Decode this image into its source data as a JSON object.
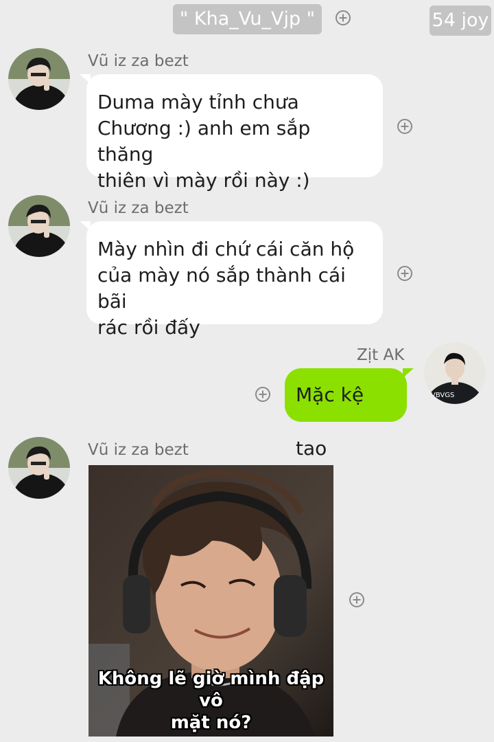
{
  "header": {
    "contact_name": "\" Kha_Vu_Vjp \"",
    "joy_count": "54 joy"
  },
  "messages": [
    {
      "sender": "Vũ iz za bezt",
      "text_lines": [
        "Duma mày tỉnh chưa",
        "Chương :) anh em sắp thăng",
        "thiên vì mày rồi này :)"
      ]
    },
    {
      "sender": "Vũ iz za bezt",
      "text_lines": [
        "Mày nhìn đi chứ cái căn hộ",
        "của mày nó sắp thành cái bãi",
        "rác rồi đấy"
      ]
    },
    {
      "sender": "Zịt AK",
      "text": "Mặc kệ tao"
    },
    {
      "sender": "Vũ iz za bezt",
      "image_caption_lines": [
        "Không lẽ giờ mình đập vô",
        "mặt nó?"
      ]
    }
  ],
  "icons": {
    "add": "plus-circle-icon",
    "avatar_in": "user-avatar",
    "avatar_out": "user-avatar"
  },
  "colors": {
    "background": "#ececec",
    "incoming_bubble": "#ffffff",
    "outgoing_bubble": "#8be000",
    "header_pill": "#c4c4c4"
  }
}
